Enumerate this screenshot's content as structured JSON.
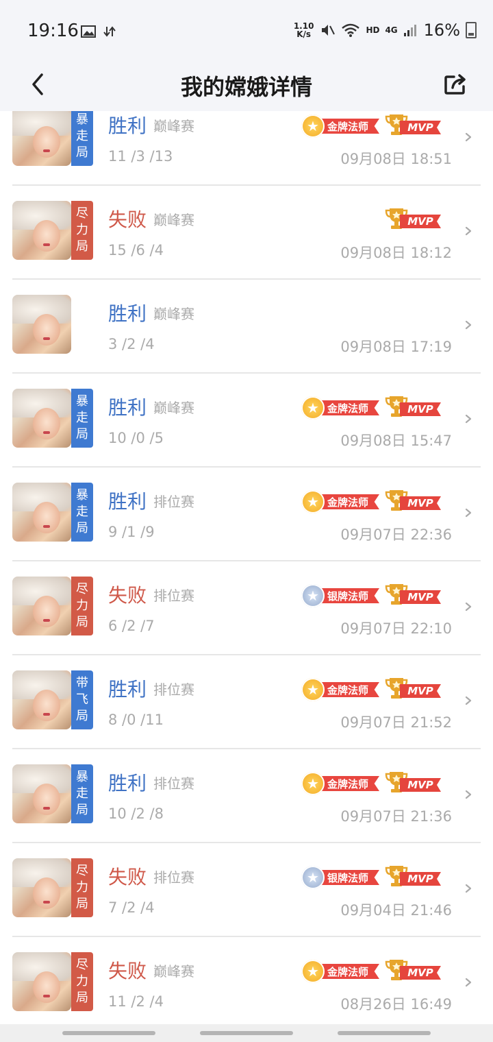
{
  "status_bar": {
    "time": "19:16",
    "net_speed_value": "1.10",
    "net_speed_unit": "K/s",
    "hd_label": "HD",
    "network_label": "4G",
    "battery": "16%"
  },
  "header": {
    "title": "我的嫦娥详情",
    "back_icon": "chevron-left-icon",
    "share_icon": "share-icon"
  },
  "matches": [
    {
      "tag": "暴走局",
      "tag_color": "#3f7ad1",
      "result": "胜利",
      "outcome": "win",
      "mode": "巅峰赛",
      "kda": "11 /3 /13",
      "medal": "金牌法师",
      "medal_type": "gold",
      "mvp": "MVP",
      "time": "09月08日 18:51"
    },
    {
      "tag": "尽力局",
      "tag_color": "#d25a47",
      "result": "失败",
      "outcome": "lose",
      "mode": "巅峰赛",
      "kda": "15 /6 /4",
      "medal": "",
      "medal_type": "",
      "mvp": "MVP",
      "time": "09月08日 18:12"
    },
    {
      "tag": "",
      "tag_color": "",
      "result": "胜利",
      "outcome": "win",
      "mode": "巅峰赛",
      "kda": "3 /2 /4",
      "medal": "",
      "medal_type": "",
      "mvp": "",
      "time": "09月08日 17:19"
    },
    {
      "tag": "暴走局",
      "tag_color": "#3f7ad1",
      "result": "胜利",
      "outcome": "win",
      "mode": "巅峰赛",
      "kda": "10 /0 /5",
      "medal": "金牌法师",
      "medal_type": "gold",
      "mvp": "MVP",
      "time": "09月08日 15:47"
    },
    {
      "tag": "暴走局",
      "tag_color": "#3f7ad1",
      "result": "胜利",
      "outcome": "win",
      "mode": "排位赛",
      "kda": "9 /1 /9",
      "medal": "金牌法师",
      "medal_type": "gold",
      "mvp": "MVP",
      "time": "09月07日 22:36"
    },
    {
      "tag": "尽力局",
      "tag_color": "#d25a47",
      "result": "失败",
      "outcome": "lose",
      "mode": "排位赛",
      "kda": "6 /2 /7",
      "medal": "银牌法师",
      "medal_type": "silver",
      "mvp": "MVP",
      "time": "09月07日 22:10"
    },
    {
      "tag": "带飞局",
      "tag_color": "#3f7ad1",
      "result": "胜利",
      "outcome": "win",
      "mode": "排位赛",
      "kda": "8 /0 /11",
      "medal": "金牌法师",
      "medal_type": "gold",
      "mvp": "MVP",
      "time": "09月07日 21:52"
    },
    {
      "tag": "暴走局",
      "tag_color": "#3f7ad1",
      "result": "胜利",
      "outcome": "win",
      "mode": "排位赛",
      "kda": "10 /2 /8",
      "medal": "金牌法师",
      "medal_type": "gold",
      "mvp": "MVP",
      "time": "09月07日 21:36"
    },
    {
      "tag": "尽力局",
      "tag_color": "#d25a47",
      "result": "失败",
      "outcome": "lose",
      "mode": "排位赛",
      "kda": "7 /2 /4",
      "medal": "银牌法师",
      "medal_type": "silver",
      "mvp": "MVP",
      "time": "09月04日 21:46"
    },
    {
      "tag": "尽力局",
      "tag_color": "#d25a47",
      "result": "失败",
      "outcome": "lose",
      "mode": "巅峰赛",
      "kda": "11 /2 /4",
      "medal": "金牌法师",
      "medal_type": "gold",
      "mvp": "MVP",
      "time": "08月26日 16:49"
    }
  ]
}
